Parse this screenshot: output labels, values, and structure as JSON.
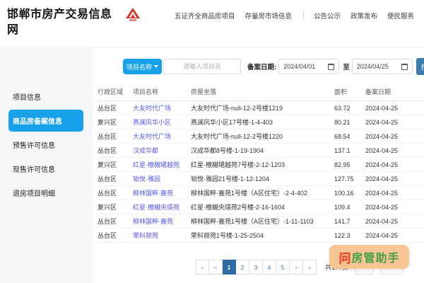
{
  "header": {
    "site_title": "邯郸市房产交易信息网",
    "nav": {
      "item0": "五证齐全商品房项目",
      "item1": "存量房市场信息",
      "item2": "公告公示",
      "item3": "政策发布",
      "item4": "便民服务"
    }
  },
  "sidebar": {
    "items": {
      "0": {
        "label": "项目信息"
      },
      "1": {
        "label": "商品房备案信息"
      },
      "2": {
        "label": "预售许可信息"
      },
      "3": {
        "label": "现售许可信息"
      },
      "4": {
        "label": "退房项目明细"
      }
    },
    "active_item": "商品房备案信息"
  },
  "filters": {
    "field_selector_value": "项目名称",
    "keyword_placeholder": "请输入项目名",
    "date_label": "备案日期:",
    "date_from": "2024/04/01",
    "to_separator": "至",
    "date_to": "2024/04/25",
    "search_label": "搜索"
  },
  "table": {
    "headers": {
      "region": "行政区域",
      "project": "项目名称",
      "location": "房屋坐落",
      "area": "面积",
      "date": "备案日期"
    },
    "rows": {
      "0": {
        "region": "丛台区",
        "project": "大友时代广场",
        "location": "大友时代广场-null-12-2号楼1219",
        "area": "63.72",
        "date": "2024-04-25"
      },
      "1": {
        "region": "复兴区",
        "project": "燕澜风华小区",
        "location": "燕澜风华小区17号楼-1-4-403",
        "area": "80.21",
        "date": "2024-04-25"
      },
      "2": {
        "region": "丛台区",
        "project": "大友时代广场",
        "location": "大友时代广场-null-12-2号楼1220",
        "area": "68.54",
        "date": "2024-04-25"
      },
      "3": {
        "region": "丛台区",
        "project": "汉成华都",
        "location": "汉成华都8号楼-1-19-1904",
        "area": "137.1",
        "date": "2024-04-25"
      },
      "4": {
        "region": "复兴区",
        "project": "红星·檀樾珺越苑",
        "location": "红星·檀樾珺越苑7号楼-2-12-1203",
        "area": "82.95",
        "date": "2024-04-25"
      },
      "5": {
        "region": "丛台区",
        "project": "铂悦·雅园",
        "location": "铂悦·雅园21号楼-1-12-1204",
        "area": "127.75",
        "date": "2024-04-25"
      },
      "6": {
        "region": "丛台区",
        "project": "柳林国粹·嘉苑",
        "location": "柳林国粹·嘉苑1号楼（A区住宅）-2-4-402",
        "area": "100.16",
        "date": "2024-04-25"
      },
      "7": {
        "region": "复兴区",
        "project": "红星·檀樾央璟苑",
        "location": "红星·檀樾央璟苑2号楼-2-16-1604",
        "area": "109.4",
        "date": "2024-04-25"
      },
      "8": {
        "region": "丛台区",
        "project": "柳林国粹·嘉苑",
        "location": "柳林国粹·嘉苑1号楼（A区住宅）-1-11-1103",
        "area": "141.7",
        "date": "2024-04-25"
      },
      "9": {
        "region": "丛台区",
        "project": "荣科丽苑",
        "location": "荣科丽苑1号楼-1-25-2504",
        "area": "122.3",
        "date": "2024-04-25"
      }
    }
  },
  "pagination": {
    "first": "«",
    "prev": "<",
    "pages": {
      "0": "1",
      "1": "2",
      "2": "3",
      "3": "4",
      "4": "5"
    },
    "active_page": "1",
    "next": ">",
    "last": "»",
    "total_text": "共177页"
  },
  "assistant": {
    "logo_char": "问",
    "label": "房管助手"
  },
  "colors": {
    "accent_blue": "#18a1e8",
    "search_button_blue": "#3d7dad",
    "project_link_blue": "#5558e3",
    "pagination_active_blue": "#2e6da4",
    "logo_red": "#d7342a",
    "assistant_bg_orange": "#f8c38c",
    "assistant_text_green": "#3f9e46",
    "assistant_logo_red": "#e8432c"
  }
}
